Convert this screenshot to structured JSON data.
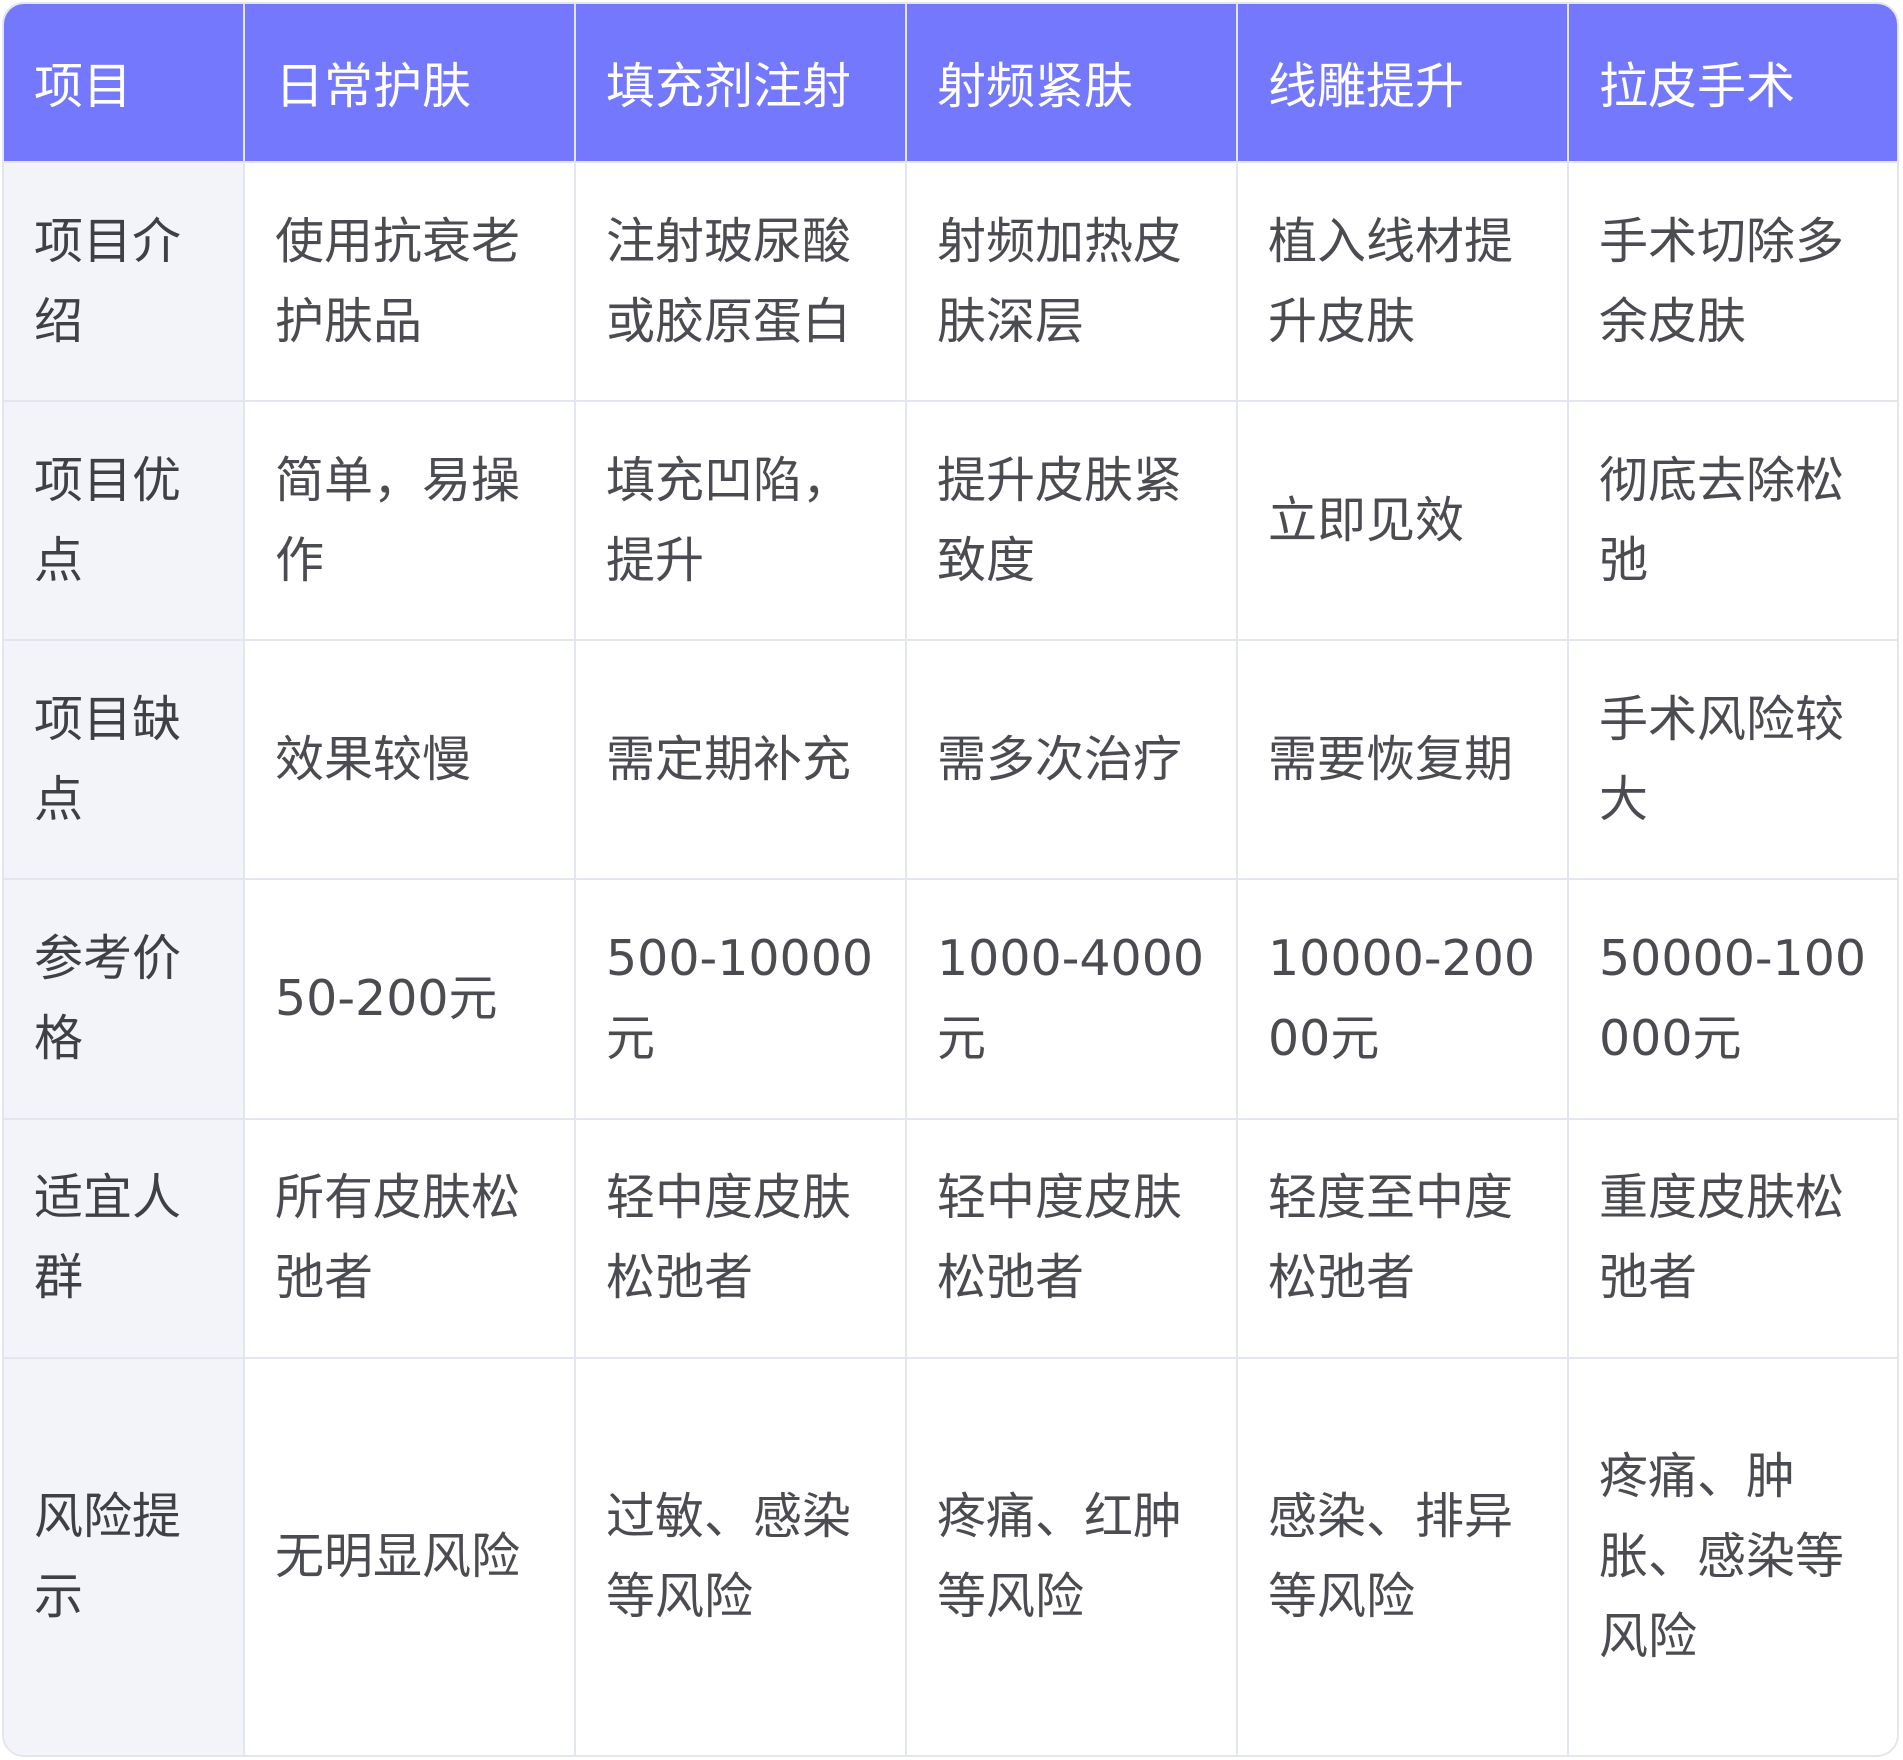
{
  "colors": {
    "header_bg": "#7378fd",
    "header_text": "#ffffff",
    "row_label_bg": "#f3f4f9",
    "cell_text": "#4b4b52",
    "border": "#e4e6ef"
  },
  "table": {
    "headers": [
      "项目",
      "日常护肤",
      "填充剂注射",
      "射频紧肤",
      "线雕提升",
      "拉皮手术"
    ],
    "rows": [
      {
        "label": "项目介绍",
        "cells": [
          "使用抗衰老护肤品",
          "注射玻尿酸或胶原蛋白",
          "射频加热皮肤深层",
          "植入线材提升皮肤",
          "手术切除多余皮肤"
        ]
      },
      {
        "label": "项目优点",
        "cells": [
          "简单，易操作",
          "填充凹陷，提升",
          "提升皮肤紧致度",
          "立即见效",
          "彻底去除松弛"
        ]
      },
      {
        "label": "项目缺点",
        "cells": [
          "效果较慢",
          "需定期补充",
          "需多次治疗",
          "需要恢复期",
          "手术风险较大"
        ]
      },
      {
        "label": "参考价格",
        "cells": [
          "50-200元",
          "500-10000元",
          "1000-4000元",
          "10000-20000元",
          "50000-100000元"
        ]
      },
      {
        "label": "适宜人群",
        "cells": [
          "所有皮肤松弛者",
          "轻中度皮肤松弛者",
          "轻中度皮肤松弛者",
          "轻度至中度松弛者",
          "重度皮肤松弛者"
        ]
      },
      {
        "label": "风险提示",
        "cells": [
          "无明显风险",
          "过敏、感染等风险",
          "疼痛、红肿等风险",
          "感染、排异等风险",
          "疼痛、肿胀、感染等风险"
        ]
      }
    ]
  }
}
